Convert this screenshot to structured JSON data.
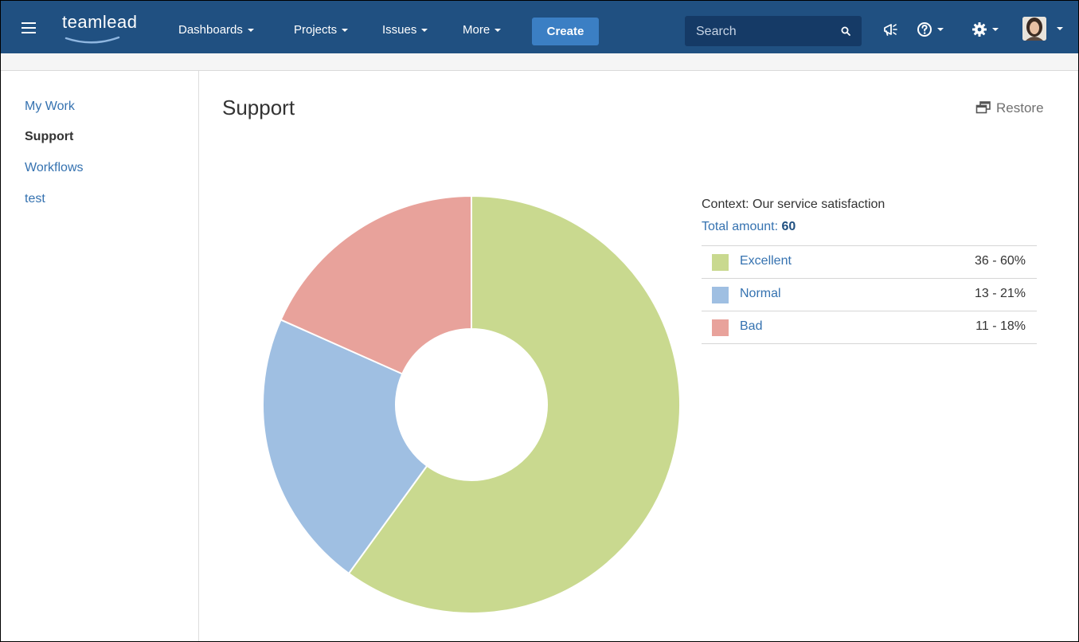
{
  "header": {
    "logo_text": "teamlead",
    "nav": [
      {
        "label": "Dashboards"
      },
      {
        "label": "Projects"
      },
      {
        "label": "Issues"
      },
      {
        "label": "More"
      }
    ],
    "create_label": "Create",
    "search_placeholder": "Search"
  },
  "sidebar": {
    "items": [
      {
        "label": "My Work",
        "active": false
      },
      {
        "label": "Support",
        "active": true
      },
      {
        "label": "Workflows",
        "active": false
      },
      {
        "label": "test",
        "active": false
      }
    ]
  },
  "main": {
    "title": "Support",
    "restore_label": "Restore"
  },
  "chart_data": {
    "type": "pie",
    "style": "donut",
    "context_label": "Context: Our service satisfaction",
    "total_label": "Total amount:",
    "total_value": "60",
    "categories": [
      "Excellent",
      "Normal",
      "Bad"
    ],
    "values": [
      36,
      13,
      11
    ],
    "value_labels": [
      "36 - 60%",
      "13 - 21%",
      "11 - 18%"
    ],
    "colors": [
      "#c9d98f",
      "#9fbfe2",
      "#e8a29b"
    ],
    "legend_position": "right"
  }
}
